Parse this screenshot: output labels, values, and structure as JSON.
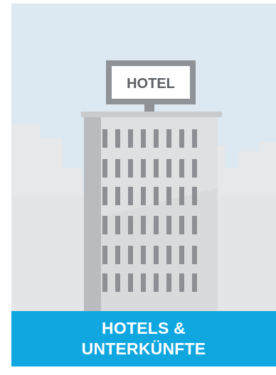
{
  "tile": {
    "sign_text": "HOTEL",
    "caption_line1": "HOTELS &",
    "caption_line2": "UNTERKÜNFTE",
    "colors": {
      "sky": "#dce8f2",
      "skyline": "#e6e8ea",
      "ground": "#e3e5e7",
      "building_front": "#d9dadc",
      "building_side": "#b9bbbe",
      "windows": "#8c8f93",
      "sign_frame": "#8f9296",
      "banner": "#10a7e1",
      "banner_text": "#ffffff"
    },
    "icons": [
      "hotel-building-illustration",
      "hotel-sign"
    ]
  }
}
